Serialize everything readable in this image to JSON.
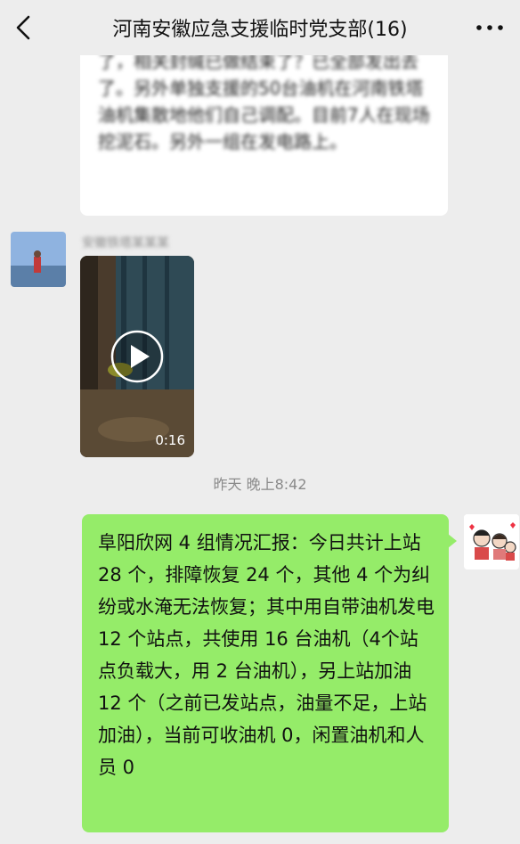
{
  "header": {
    "title": "河南安徽应急支援临时党支部(16)"
  },
  "icons": {
    "back": "chevron-left-icon",
    "more": "more-dots-icon",
    "play": "play-icon"
  },
  "messages": {
    "prev_text": "了，相关封缄已做结束了？已全部发出去了。另外单独支援的50台油机在河南铁塔油机集散地他们自己调配。目前7人在现场挖泥石。另外一组在发电路上。",
    "sender_name": "安徽铁塔某某某",
    "video_duration": "0:16",
    "timestamp": "昨天 晚上8:42",
    "report_text": "阜阳欣网 4 组情况汇报：今日共计上站 28 个，排障恢复 24 个，其他 4 个为纠纷或水淹无法恢复；其中用自带油机发电 12 个站点，共使用 16 台油机（4个站点负载大，用 2 台油机），另上站加油 12 个（之前已发站点，油量不足，上站加油），当前可收油机 0，闲置油机和人员 0"
  },
  "colors": {
    "background": "#ededed",
    "self_bubble": "#95ec69",
    "other_bubble": "#ffffff"
  }
}
